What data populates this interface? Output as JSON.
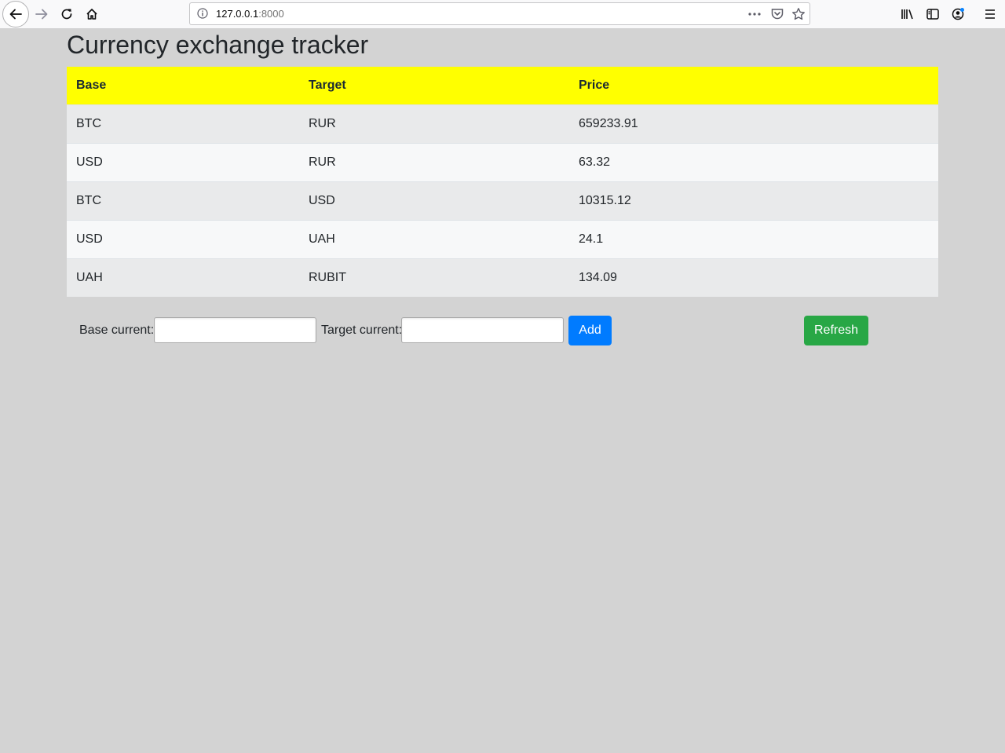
{
  "browser": {
    "url_host": "127.0.0.1",
    "url_port": ":8000"
  },
  "page": {
    "title": "Currency exchange tracker"
  },
  "table": {
    "headers": {
      "base": "Base",
      "target": "Target",
      "price": "Price"
    },
    "rows": [
      {
        "base": "BTC",
        "target": "RUR",
        "price": "659233.91"
      },
      {
        "base": "USD",
        "target": "RUR",
        "price": "63.32"
      },
      {
        "base": "BTC",
        "target": "USD",
        "price": "10315.12"
      },
      {
        "base": "USD",
        "target": "UAH",
        "price": "24.1"
      },
      {
        "base": "UAH",
        "target": "RUBIT",
        "price": "134.09"
      }
    ]
  },
  "form": {
    "base_label": "Base current:",
    "base_value": "",
    "target_label": "Target current:",
    "target_value": "",
    "add_label": "Add",
    "refresh_label": "Refresh"
  },
  "colors": {
    "header_bg": "#ffff00",
    "add_button": "#007bff",
    "refresh_button": "#28a745",
    "page_bg": "#d3d3d3"
  }
}
